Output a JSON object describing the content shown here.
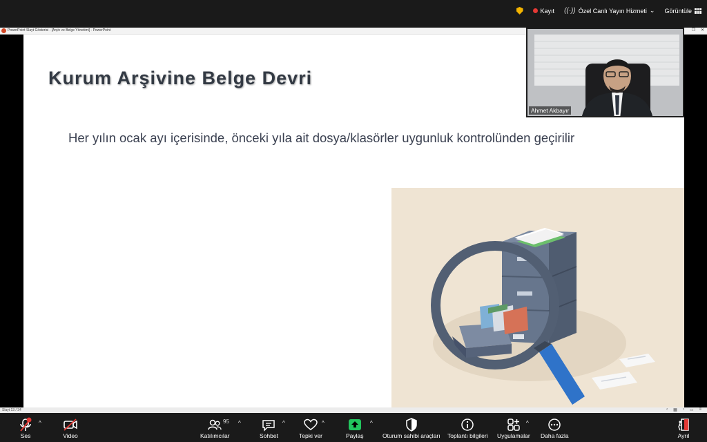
{
  "top_bar": {
    "recording_label": "Kayıt",
    "live_stream_label": "Özel Canlı Yayın Hizmeti",
    "view_label": "Görüntüle"
  },
  "ppt": {
    "window_title": "PowerPoint Slayt Gösterisi - [Arşiv ve Belge Yönetimi] - PowerPoint",
    "status_slide": "Slayt 13 / 34"
  },
  "slide": {
    "title": "Kurum Arşivine Belge Devri",
    "body": "Her yılın ocak ayı içerisinde, önceki yıla ait dosya/klasörler uygunluk kontrolünden geçirilir"
  },
  "participant": {
    "name": "Ahmet Akbayır"
  },
  "toolbar": {
    "audio_label": "Ses",
    "video_label": "Video",
    "participants_label": "Katılımcılar",
    "participants_count": "95",
    "chat_label": "Sohbet",
    "reactions_label": "Tepki ver",
    "share_label": "Paylaş",
    "host_tools_label": "Oturum sahibi araçları",
    "meeting_info_label": "Toplantı bilgileri",
    "apps_label": "Uygulamalar",
    "more_label": "Daha fazla",
    "leave_label": "Ayrıl"
  },
  "colors": {
    "toolbar_bg": "#1a1a1a",
    "share_green": "#22c55e",
    "record_red": "#e53935",
    "slide_title": "#333a44",
    "illustration_bg": "#efe4d3",
    "cabinet": "#5f6d83",
    "magnifier_handle": "#2f73c9"
  },
  "icons": {
    "audio": "microphone-muted-icon",
    "video": "camera-off-icon",
    "participants": "people-icon",
    "chat": "chat-bubble-icon",
    "reactions": "heart-icon",
    "share": "share-arrow-icon",
    "host_tools": "shield-icon",
    "meeting_info": "info-icon",
    "apps": "apps-icon",
    "more": "ellipsis-icon",
    "leave": "exit-icon"
  }
}
